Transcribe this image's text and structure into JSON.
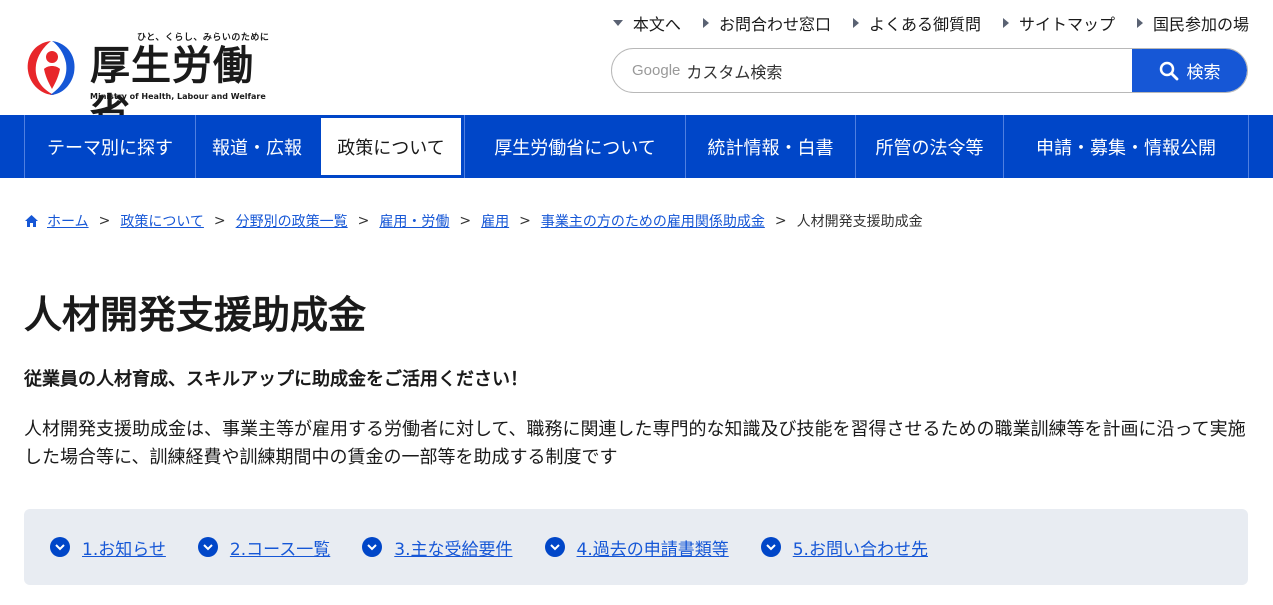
{
  "site": {
    "tagline": "ひと、くらし、みらいのために",
    "name": "厚生労働省",
    "name_en": "Ministry of Health, Labour and Welfare"
  },
  "util_nav": [
    {
      "label": "本文へ",
      "icon": "arrow-down-icon"
    },
    {
      "label": "お問合わせ窓口",
      "icon": "arrow-right-icon"
    },
    {
      "label": "よくある御質問",
      "icon": "arrow-right-icon"
    },
    {
      "label": "サイトマップ",
      "icon": "arrow-right-icon"
    },
    {
      "label": "国民参加の場",
      "icon": "arrow-right-icon"
    }
  ],
  "search": {
    "brand": "Google",
    "placeholder": "カスタム検索",
    "button_label": "検索"
  },
  "gnav": [
    {
      "label": "テーマ別に探す",
      "active": false
    },
    {
      "label": "報道・広報",
      "active": false
    },
    {
      "label": "政策について",
      "active": true
    },
    {
      "label": "厚生労働省について",
      "active": false
    },
    {
      "label": "統計情報・白書",
      "active": false
    },
    {
      "label": "所管の法令等",
      "active": false
    },
    {
      "label": "申請・募集・情報公開",
      "active": false
    }
  ],
  "breadcrumb": [
    "ホーム",
    "政策について",
    "分野別の政策一覧",
    "雇用・労働",
    "雇用",
    "事業主の方のための雇用関係助成金"
  ],
  "breadcrumb_current": "人材開発支援助成金",
  "page": {
    "title": "人材開発支援助成金",
    "lead": "従業員の人材育成、スキルアップに助成金をご活用ください！",
    "description": "人材開発支援助成金は、事業主等が雇用する労働者に対して、職務に関連した専門的な知識及び技能を習得させるための職業訓練等を計画に沿って実施した場合等に、訓練経費や訓練期間中の賃金の一部等を助成する制度です"
  },
  "anchors": [
    "1.お知らせ",
    "2.コース一覧",
    "3.主な受給要件",
    "4.過去の申請書類等",
    "5.お問い合わせ先"
  ],
  "colors": {
    "brand_blue": "#0046c8",
    "link_blue": "#1657d6",
    "anchor_bg": "#e8ecf2"
  }
}
